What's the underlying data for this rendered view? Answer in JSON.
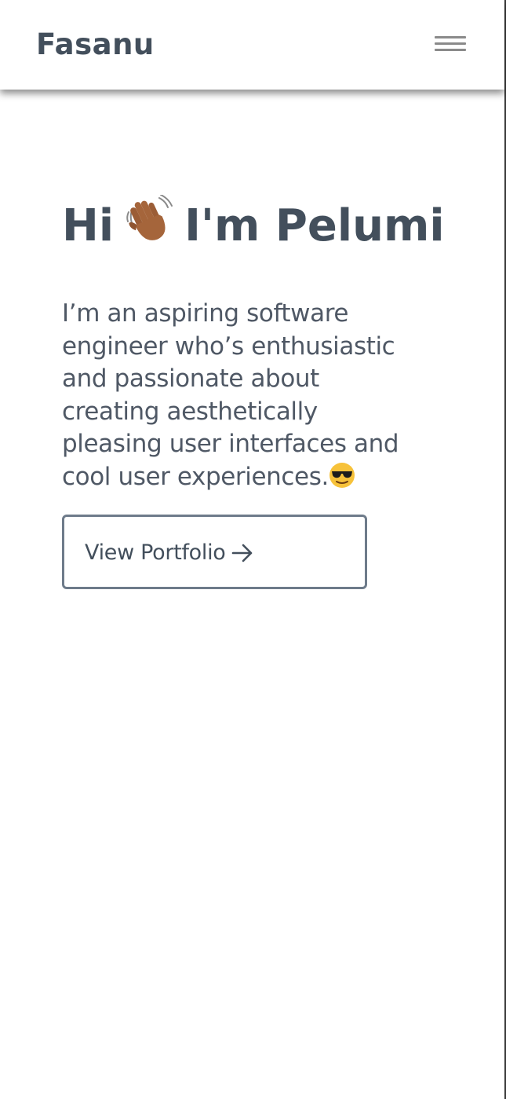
{
  "header": {
    "logo_text": "Fasanu",
    "menu_icon": "hamburger-menu-icon"
  },
  "hero": {
    "greeting_before": "Hi",
    "greeting_emoji": "waving-hand-emoji",
    "greeting_after": "I'm Pelumi",
    "description": "I’m an aspiring software engineer who’s enthusiastic and passionate about creating aesthetically pleasing user interfaces and cool user experiences.",
    "description_emoji": "smiling-face-with-sunglasses-emoji"
  },
  "cta": {
    "label": "View Portfolio",
    "icon": "arrow-right-icon"
  },
  "colors": {
    "text_primary": "#434f5c",
    "button_border": "#6e7b8a",
    "menu_bars": "#8a8a8a",
    "background": "#ffffff"
  }
}
